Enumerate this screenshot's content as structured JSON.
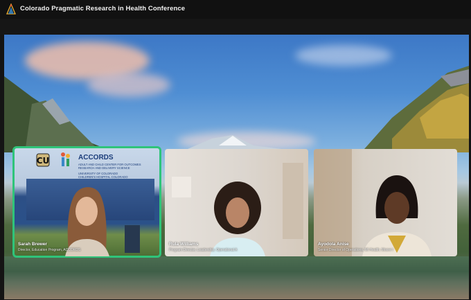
{
  "window": {
    "title": "Colorado Pragmatic Research in Health Conference"
  },
  "participants": [
    {
      "name": "Sarah Brewer",
      "role": "Director, Education Program, ACCORDS",
      "active": true,
      "background": {
        "org_short": "ACCORDS",
        "org_long_1": "ADULT AND CHILD CENTER FOR OUTCOMES",
        "org_long_2": "RESEARCH AND DELIVERY SCIENCE",
        "affil_1": "UNIVERSITY OF COLORADO",
        "affil_2": "CHILDREN'S HOSPITAL COLORADO"
      }
    },
    {
      "name": "Rula Williams",
      "role": "Program Director, Leadership, Operational A",
      "active": false
    },
    {
      "name": "Ayodola Anise",
      "role": "Senior Director of Operations, MI Health, Moore I",
      "active": false
    }
  ],
  "colors": {
    "active_speaker_border": "#2fc47a",
    "top_bar": "#111111"
  }
}
